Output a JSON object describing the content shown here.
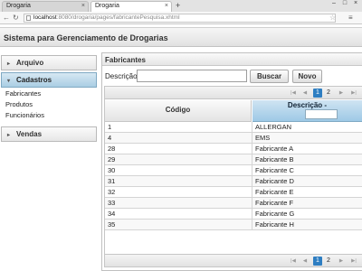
{
  "browser": {
    "tabs": [
      {
        "label": "Drogaria"
      },
      {
        "label": "Drogaria"
      }
    ],
    "url_host": "localhost",
    "url_path": ":8080/drogaria/pages/fabricantePesquisa.xhtml",
    "new_tab_glyph": "+",
    "window_controls": [
      "–",
      "□",
      "×"
    ]
  },
  "app": {
    "title": "Sistema para Gerenciamento de Drogarias"
  },
  "sidebar": {
    "sections": [
      {
        "label": "Arquivo",
        "expanded": false
      },
      {
        "label": "Cadastros",
        "expanded": true
      },
      {
        "label": "Vendas",
        "expanded": false
      }
    ],
    "cadastros_items": [
      {
        "label": "Fabricantes"
      },
      {
        "label": "Produtos"
      },
      {
        "label": "Funcionários"
      }
    ]
  },
  "panel": {
    "title": "Fabricantes",
    "search_label": "Descrição:",
    "search_value": "",
    "buttons": {
      "buscar": "Buscar",
      "novo": "Novo"
    }
  },
  "table": {
    "columns": [
      "Código",
      "Descrição -"
    ],
    "pages": [
      "1",
      "2"
    ],
    "current_page": "1",
    "rows": [
      {
        "codigo": "1",
        "descricao": "ALLERGAN"
      },
      {
        "codigo": "4",
        "descricao": "EMS"
      },
      {
        "codigo": "28",
        "descricao": "Fabricante A"
      },
      {
        "codigo": "29",
        "descricao": "Fabricante B"
      },
      {
        "codigo": "30",
        "descricao": "Fabricante C"
      },
      {
        "codigo": "31",
        "descricao": "Fabricante D"
      },
      {
        "codigo": "32",
        "descricao": "Fabricante E"
      },
      {
        "codigo": "33",
        "descricao": "Fabricante F"
      },
      {
        "codigo": "34",
        "descricao": "Fabricante G"
      },
      {
        "codigo": "35",
        "descricao": "Fabricante H"
      }
    ]
  },
  "colors": {
    "accent": "#2e7ec2",
    "sorted_header": "#a9cde3"
  }
}
